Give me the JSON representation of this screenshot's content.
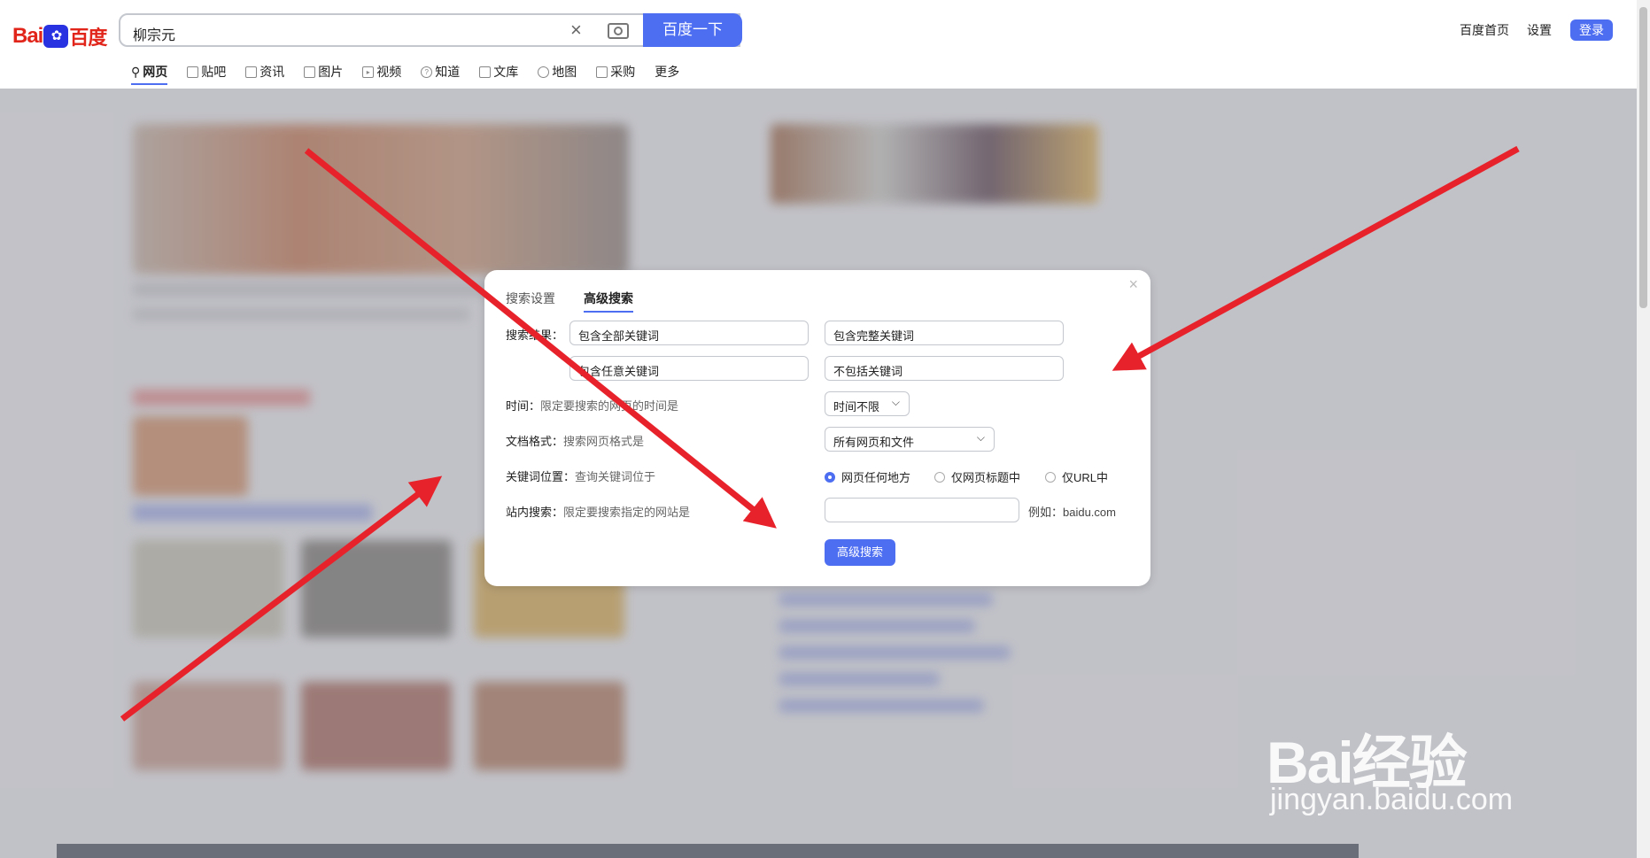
{
  "header": {
    "logo_text_bai": "Bai",
    "logo_text_du": "百度",
    "search_query": "柳宗元",
    "search_button": "百度一下",
    "home_link": "百度首页",
    "settings_link": "设置",
    "login_button": "登录"
  },
  "tabs": [
    {
      "label": "网页",
      "icon": "search-icon"
    },
    {
      "label": "贴吧",
      "icon": "tieba-icon"
    },
    {
      "label": "资讯",
      "icon": "news-icon"
    },
    {
      "label": "图片",
      "icon": "image-icon"
    },
    {
      "label": "视频",
      "icon": "video-icon"
    },
    {
      "label": "知道",
      "icon": "question-icon"
    },
    {
      "label": "文库",
      "icon": "doc-icon"
    },
    {
      "label": "地图",
      "icon": "map-icon"
    },
    {
      "label": "采购",
      "icon": "cart-icon"
    },
    {
      "label": "更多",
      "icon": ""
    }
  ],
  "modal": {
    "tab_settings": "搜索设置",
    "tab_advanced": "高级搜索",
    "result_label": "搜索结果：",
    "all_keywords": "包含全部关键词",
    "exact_keywords": "包含完整关键词",
    "any_keywords": "包含任意关键词",
    "exclude_keywords": "不包括关键词",
    "time_label": "时间：",
    "time_sub": "限定要搜索的网页的时间是",
    "time_value": "时间不限",
    "format_label": "文档格式：",
    "format_sub": "搜索网页格式是",
    "format_value": "所有网页和文件",
    "position_label": "关键词位置：",
    "position_sub": "查询关键词位于",
    "radio_anywhere": "网页任何地方",
    "radio_title": "仅网页标题中",
    "radio_url": "仅URL中",
    "site_label": "站内搜索：",
    "site_sub": "限定要搜索指定的网站是",
    "site_example": "例如：baidu.com",
    "submit": "高级搜索"
  },
  "watermark": {
    "brand": "Bai经验",
    "url": "jingyan.baidu.com"
  },
  "colors": {
    "accent": "#4e6ef2",
    "arrow": "#e8222a",
    "brand_red": "#e1251b"
  }
}
